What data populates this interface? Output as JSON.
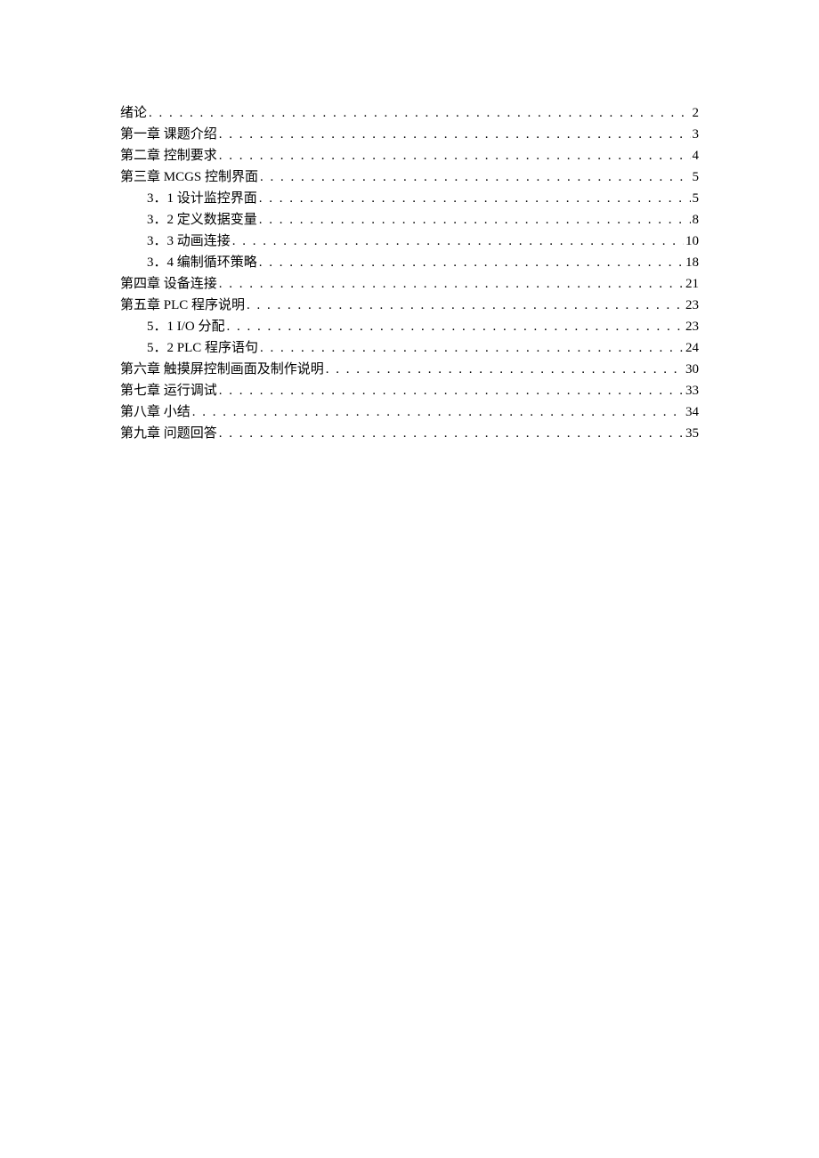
{
  "toc": [
    {
      "label": "绪论",
      "page": "2",
      "indent": 0
    },
    {
      "label": "第一章 课题介绍",
      "page": "3",
      "indent": 0
    },
    {
      "label": "第二章 控制要求",
      "page": "4",
      "indent": 0
    },
    {
      "label": "第三章 MCGS 控制界面",
      "page": "5",
      "indent": 0
    },
    {
      "label": "3．1 设计监控界面",
      "page": "5",
      "indent": 1
    },
    {
      "label": "3．2 定义数据变量",
      "page": "8",
      "indent": 1
    },
    {
      "label": "3．3 动画连接",
      "page": "10",
      "indent": 1
    },
    {
      "label": "3．4 编制循环策略",
      "page": "18",
      "indent": 1
    },
    {
      "label": "第四章 设备连接",
      "page": "21",
      "indent": 0
    },
    {
      "label": "第五章 PLC 程序说明",
      "page": "23",
      "indent": 0
    },
    {
      "label": "5．1 I/O 分配",
      "page": "23",
      "indent": 1
    },
    {
      "label": "5．2 PLC 程序语句",
      "page": "24",
      "indent": 1
    },
    {
      "label": "第六章 触摸屏控制画面及制作说明",
      "page": "30",
      "indent": 0
    },
    {
      "label": "第七章 运行调试",
      "page": "33",
      "indent": 0
    },
    {
      "label": "第八章 小结",
      "page": "34",
      "indent": 0
    },
    {
      "label": "第九章 问题回答",
      "page": "35",
      "indent": 0
    }
  ],
  "dots": ". . . . . . . . . . . . . . . . . . . . . . . . . . . . . . . . . . . . . . . . . . . . . . . . . . . . . . . . . . . . . . . . . . . . . . . . . . . . . . . . . . . . . . . . . . . . . . . . . . . . . . . . . . . . . . . . . . . . . . . . . . . . . . . . . . . . . . . . . . . . . . . ."
}
